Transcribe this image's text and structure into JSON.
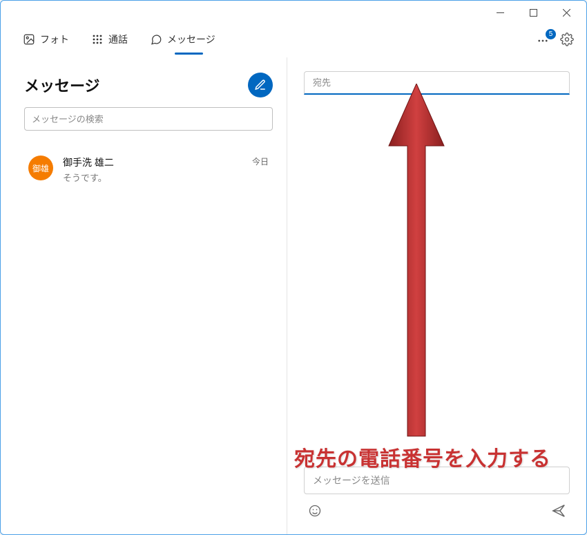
{
  "window": {
    "badge_count": "5"
  },
  "tabs": {
    "photo": "フォト",
    "calls": "通話",
    "messages": "メッセージ"
  },
  "left": {
    "title": "メッセージ",
    "search_placeholder": "メッセージの検索"
  },
  "conversations": [
    {
      "avatar_initials": "御雄",
      "name": "御手洗 雄二",
      "preview": "そうです。",
      "time": "今日"
    }
  ],
  "compose": {
    "to_placeholder": "宛先",
    "message_placeholder": "メッセージを送信"
  },
  "annotation": {
    "text": "宛先の電話番号を入力する"
  },
  "colors": {
    "accent": "#0067c0",
    "avatar_bg": "#f57c00",
    "annotation_red": "#c83232"
  }
}
